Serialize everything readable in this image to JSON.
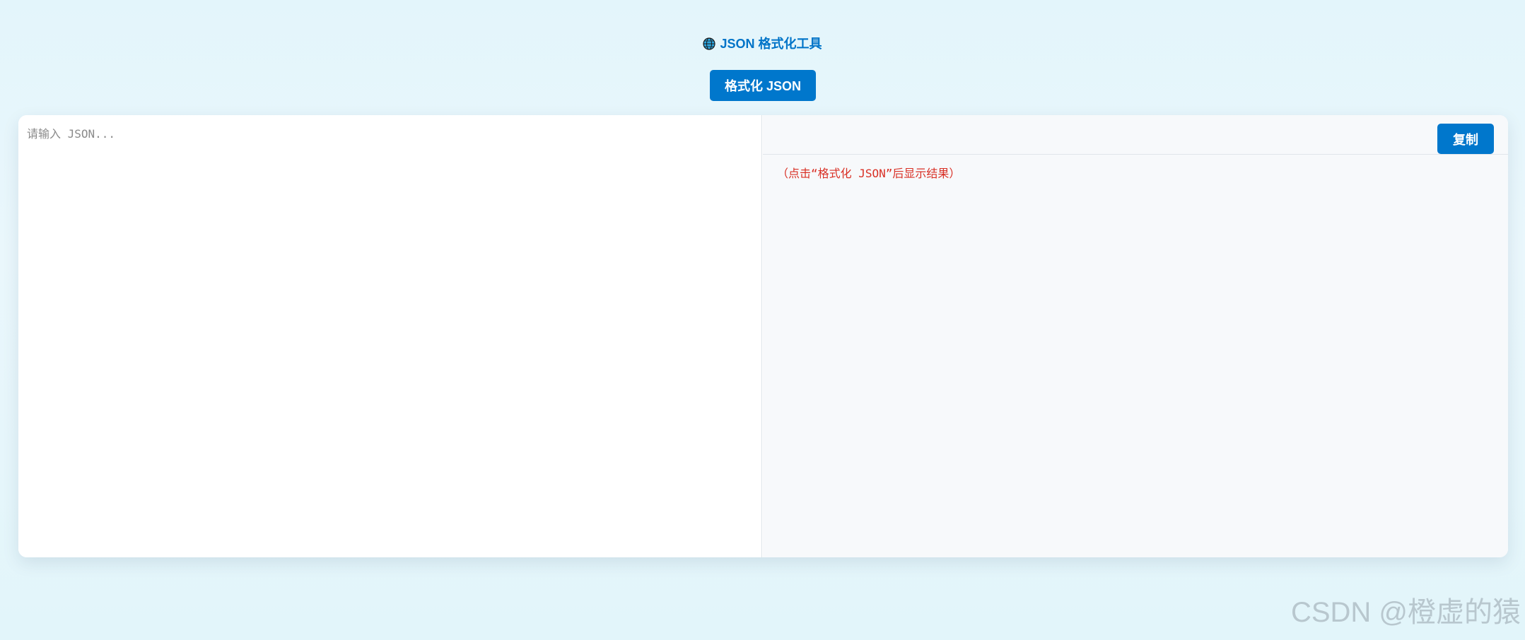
{
  "header": {
    "icon": "globe-icon",
    "title": "JSON 格式化工具"
  },
  "toolbar": {
    "format_label": "格式化 JSON"
  },
  "input": {
    "placeholder": "请输入 JSON...",
    "value": ""
  },
  "output": {
    "copy_label": "复制",
    "placeholder_text": "（点击“格式化 JSON”后显示结果）"
  },
  "watermark": {
    "text": "CSDN @橙虚的猿"
  },
  "colors": {
    "accent": "#0077cc",
    "title": "#0074c8",
    "hint": "#d93025",
    "background": "#e6f6fb"
  }
}
